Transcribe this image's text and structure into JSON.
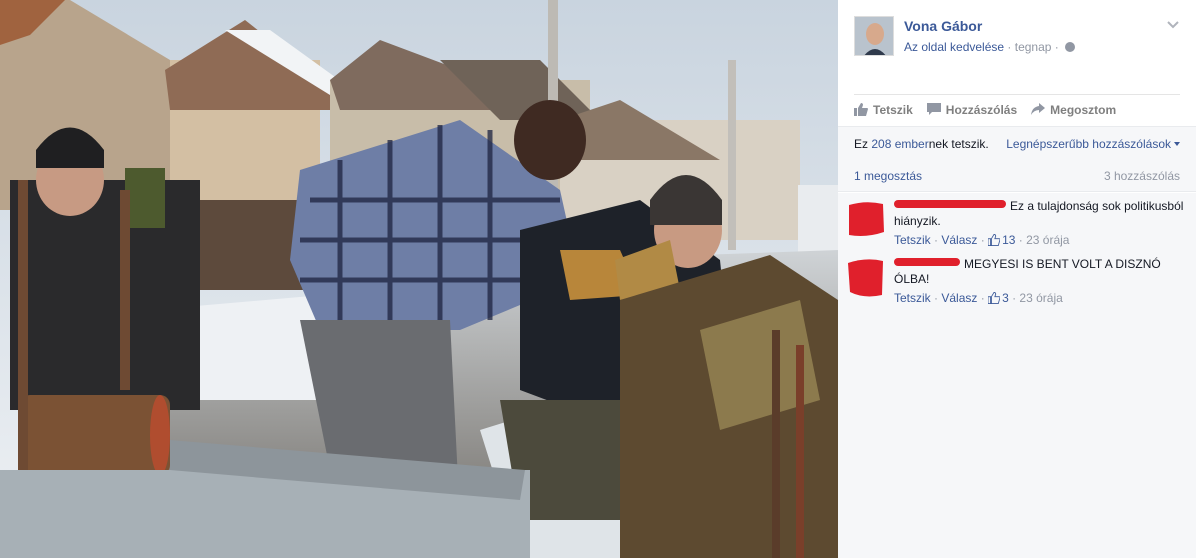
{
  "photo": {
    "description_icon": "photo-image"
  },
  "post": {
    "page_name": "Vona Gábor",
    "like_page_link": "Az oldal kedvelése",
    "separator": " · ",
    "time": "tegnap",
    "separator2": " · "
  },
  "actions": {
    "like": "Tetszik",
    "comment": "Hozzászólás",
    "share": "Megosztom"
  },
  "likes": {
    "prefix": "Ez ",
    "link": "208 ember",
    "suffix": "nek tetszik.",
    "sort_label": "Legnépszerűbb hozzászólások"
  },
  "stats": {
    "shares": "1 megosztás",
    "comments": "3 hozzászólás"
  },
  "comments": [
    {
      "text": "Ez a tulajdonság sok politikusból hiányzik.",
      "like_label": "Tetszik",
      "reply_label": "Válasz",
      "like_count": "13",
      "time": "23 órája",
      "sep": " · "
    },
    {
      "text": "MEGYESI IS BENT VOLT A DISZNÓ ÓLBA!",
      "like_label": "Tetszik",
      "reply_label": "Válasz",
      "like_count": "3",
      "time": "23 órája",
      "sep": " · "
    }
  ],
  "colors": {
    "brand": "#3b5998",
    "muted": "#9197a3",
    "redaction": "#e0202c"
  }
}
